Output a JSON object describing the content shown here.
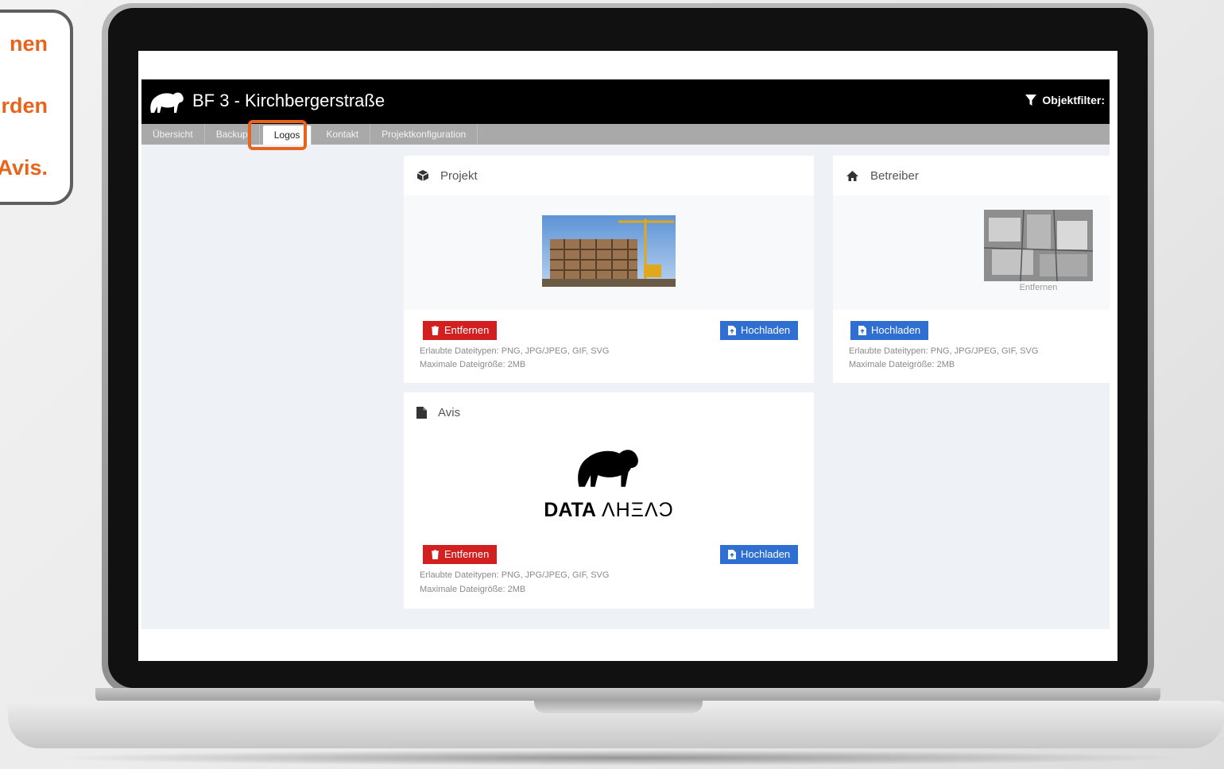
{
  "callout": {
    "lines": [
      "nen",
      "rden",
      ",",
      "Avis."
    ]
  },
  "app": {
    "title": "BF 3 - Kirchbergerstraße",
    "filter_label": "Objektfilter:",
    "tabs": [
      "Übersicht",
      "Backup",
      "Logos",
      "Kontakt",
      "Projektkonfiguration"
    ],
    "active_tab": "Logos"
  },
  "panels": {
    "projekt": {
      "title": "Projekt",
      "remove_label": "Entfernen",
      "upload_label": "Hochladen",
      "hint1": "Erlaubte Dateitypen: PNG, JPG/JPEG, GIF, SVG",
      "hint2": "Maximale Dateigröße: 2MB"
    },
    "betreiber": {
      "title": "Betreiber",
      "image_caption": "Entfernen",
      "upload_label": "Hochladen",
      "hint1": "Erlaubte Dateitypen: PNG, JPG/JPEG, GIF, SVG",
      "hint2": "Maximale Dateigröße: 2MB"
    },
    "avis": {
      "title": "Avis",
      "logo_text_bold": "DATA",
      "logo_text_light": "ΛHΞΛƆ",
      "remove_label": "Entfernen",
      "upload_label": "Hochladen",
      "hint1": "Erlaubte Dateitypen: PNG, JPG/JPEG, GIF, SVG",
      "hint2": "Maximale Dateigröße: 2MB"
    }
  },
  "colors": {
    "accent": "#e8631b",
    "remove": "#d21f1f",
    "upload": "#2f6fd2",
    "header": "#000000",
    "tabbar": "#a9a9a9"
  }
}
